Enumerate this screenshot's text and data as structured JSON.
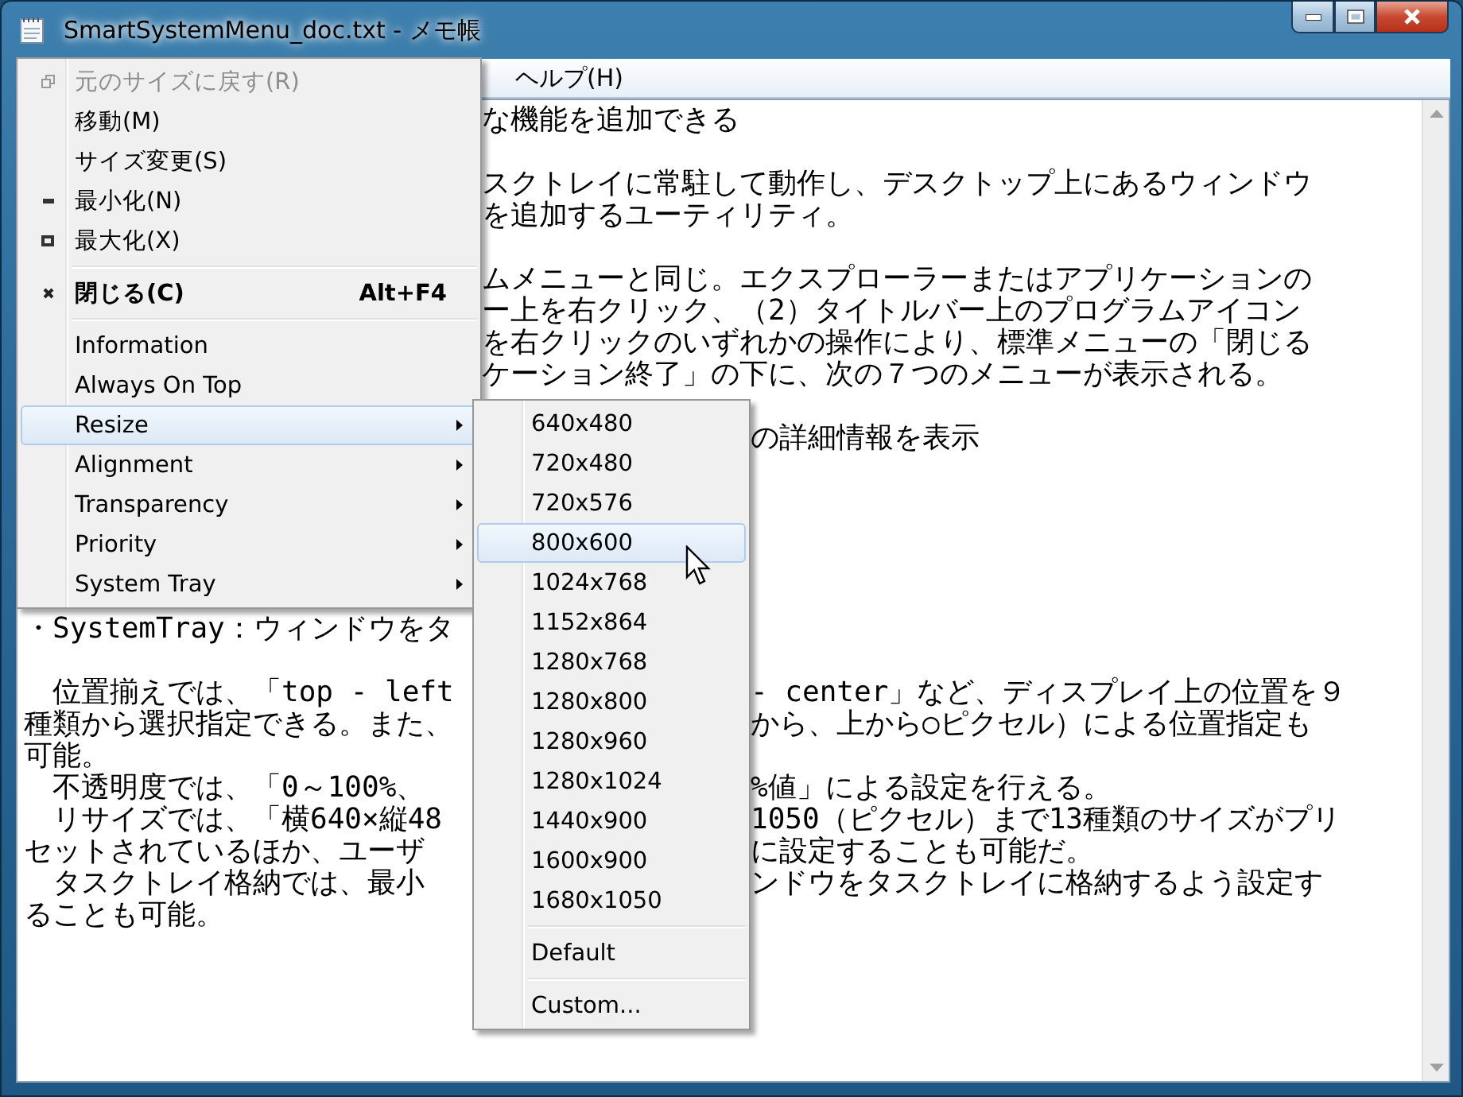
{
  "window": {
    "title": "SmartSystemMenu_doc.txt - メモ帳"
  },
  "menu_bar": [
    {
      "label": "ヘルプ(H)"
    }
  ],
  "editor": {
    "upper": [
      [
        {
          "right": "な機能を追加できる"
        }
      ],
      [
        {
          "right": "スクトレイに常駐して動作し、デスクトップ上にあるウィンドウ"
        },
        {
          "right": "を追加するユーティリティ。"
        }
      ],
      [
        {
          "right": "ムメニューと同じ。エクスプローラーまたはアプリケーションの"
        },
        {
          "right": "ー上を右クリック、（2）タイトルバー上のプログラムアイコン"
        },
        {
          "right": "を右クリックのいずれかの操作により、標準メニューの「閉じる"
        },
        {
          "right": "ケーション終了」の下に、次の７つのメニューが表示される。"
        }
      ],
      [
        {
          "right": "の詳細情報を表示"
        }
      ]
    ],
    "lower": [
      [
        {
          "left": "・SystemTray：ウィンドウをタ"
        }
      ],
      [
        {
          "left": "　位置揃えでは、「top - left",
          "right": "- center」など、ディスプレイ上の位置を９"
        },
        {
          "left": "種類から選択指定できる。また、",
          "right": "から、上から○ピクセル）による位置指定も"
        },
        {
          "left": "可能。"
        },
        {
          "left": "　不透明度では、「0～100%、",
          "right": "%値」による設定を行える。"
        },
        {
          "left": "　リサイズでは、「横640×縦48",
          "right": "1050（ピクセル）まで13種類のサイズがプリ"
        },
        {
          "left": "セットされているほか、ユーザ",
          "right": "に設定することも可能だ。"
        },
        {
          "left": "　タスクトレイ格納では、最小",
          "right": "ンドウをタスクトレイに格納するよう設定す"
        },
        {
          "left": "ることも可能。"
        }
      ]
    ]
  },
  "system_menu": {
    "items": [
      {
        "kind": "item",
        "label": "元のサイズに戻す(R)",
        "disabled": true,
        "selected": false
      },
      {
        "kind": "item",
        "label": "移動(M)",
        "disabled": false,
        "selected": false
      },
      {
        "kind": "item",
        "label": "サイズ変更(S)",
        "disabled": false,
        "selected": false
      },
      {
        "kind": "item",
        "label": "最小化(N)",
        "disabled": false,
        "selected": false
      },
      {
        "kind": "item",
        "label": "最大化(X)",
        "disabled": false,
        "selected": false
      },
      {
        "kind": "separator"
      },
      {
        "kind": "default",
        "label": "閉じる(C)",
        "shortcut": "Alt+F4",
        "disabled": false,
        "selected": false
      },
      {
        "kind": "separator"
      },
      {
        "kind": "item",
        "label": "Information",
        "disabled": false,
        "selected": false
      },
      {
        "kind": "item",
        "label": "Always On Top",
        "disabled": false,
        "selected": false
      },
      {
        "kind": "submenu",
        "label": "Resize",
        "disabled": false,
        "selected": true
      },
      {
        "kind": "submenu",
        "label": "Alignment",
        "disabled": false,
        "selected": false
      },
      {
        "kind": "submenu",
        "label": "Transparency",
        "disabled": false,
        "selected": false
      },
      {
        "kind": "submenu",
        "label": "Priority",
        "disabled": false,
        "selected": false
      },
      {
        "kind": "submenu",
        "label": "System Tray",
        "disabled": false,
        "selected": false
      }
    ]
  },
  "resize_menu": {
    "items": [
      {
        "kind": "item",
        "label": "640x480",
        "selected": false
      },
      {
        "kind": "item",
        "label": "720x480",
        "selected": false
      },
      {
        "kind": "item",
        "label": "720x576",
        "selected": false
      },
      {
        "kind": "item",
        "label": "800x600",
        "selected": true
      },
      {
        "kind": "item",
        "label": "1024x768",
        "selected": false
      },
      {
        "kind": "item",
        "label": "1152x864",
        "selected": false
      },
      {
        "kind": "item",
        "label": "1280x768",
        "selected": false
      },
      {
        "kind": "item",
        "label": "1280x800",
        "selected": false
      },
      {
        "kind": "item",
        "label": "1280x960",
        "selected": false
      },
      {
        "kind": "item",
        "label": "1280x1024",
        "selected": false
      },
      {
        "kind": "item",
        "label": "1440x900",
        "selected": false
      },
      {
        "kind": "item",
        "label": "1600x900",
        "selected": false
      },
      {
        "kind": "item",
        "label": "1680x1050",
        "selected": false
      },
      {
        "kind": "separator"
      },
      {
        "kind": "item",
        "label": "Default",
        "selected": false
      },
      {
        "kind": "separator"
      },
      {
        "kind": "item",
        "label": "Custom...",
        "selected": false
      }
    ]
  }
}
